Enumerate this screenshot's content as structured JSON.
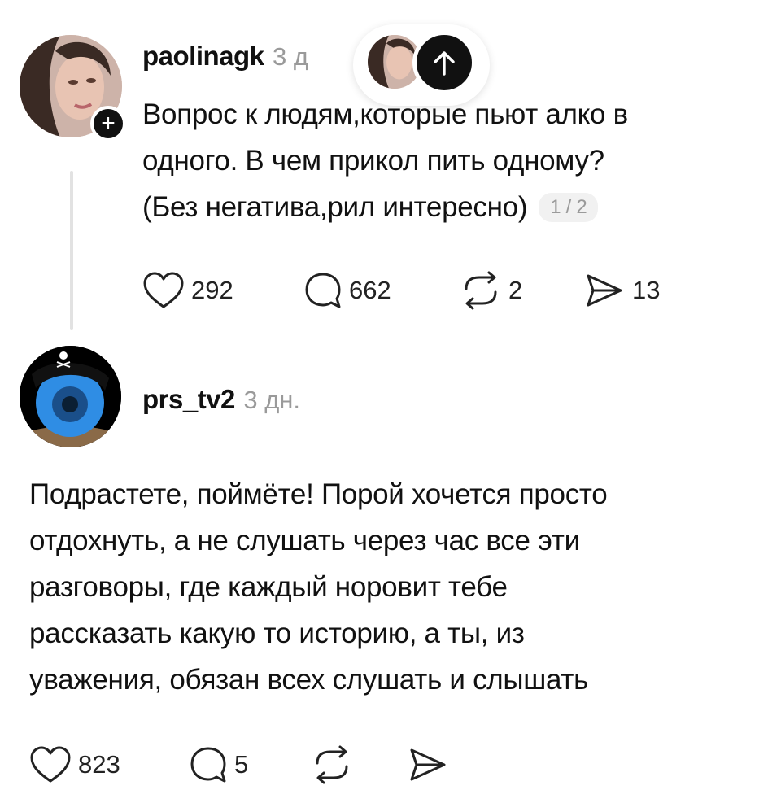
{
  "post1": {
    "username": "paolinagk",
    "time": "3 д",
    "text_lines": [
      "Вопрос к людям,которые пьют алко в",
      "одного. В чем прикол пить одному?",
      "(Без негатива,рил интересно)"
    ],
    "page_indicator": "1 / 2",
    "likes": "292",
    "comments": "662",
    "reposts": "2",
    "shares": "13"
  },
  "reply": {
    "username": "prs_tv2",
    "time": "3 дн.",
    "text_lines": [
      "Подрастете, поймёте!  Порой хочется просто",
      "отдохнуть, а не слушать через час все эти",
      "разговоры, где каждый норовит тебе",
      "рассказать какую то историю, а ты, из",
      "уважения, обязан всех слушать и слышать"
    ],
    "likes": "823",
    "comments": "5"
  },
  "icons": {
    "like": "heart-icon",
    "comment": "comment-bubble-icon",
    "repost": "repost-icon",
    "share": "send-icon",
    "follow": "plus-icon",
    "scroll_top": "arrow-up-icon"
  },
  "colors": {
    "text": "#111111",
    "muted": "#9a9a9a",
    "thread_line": "#e2e2e2"
  }
}
